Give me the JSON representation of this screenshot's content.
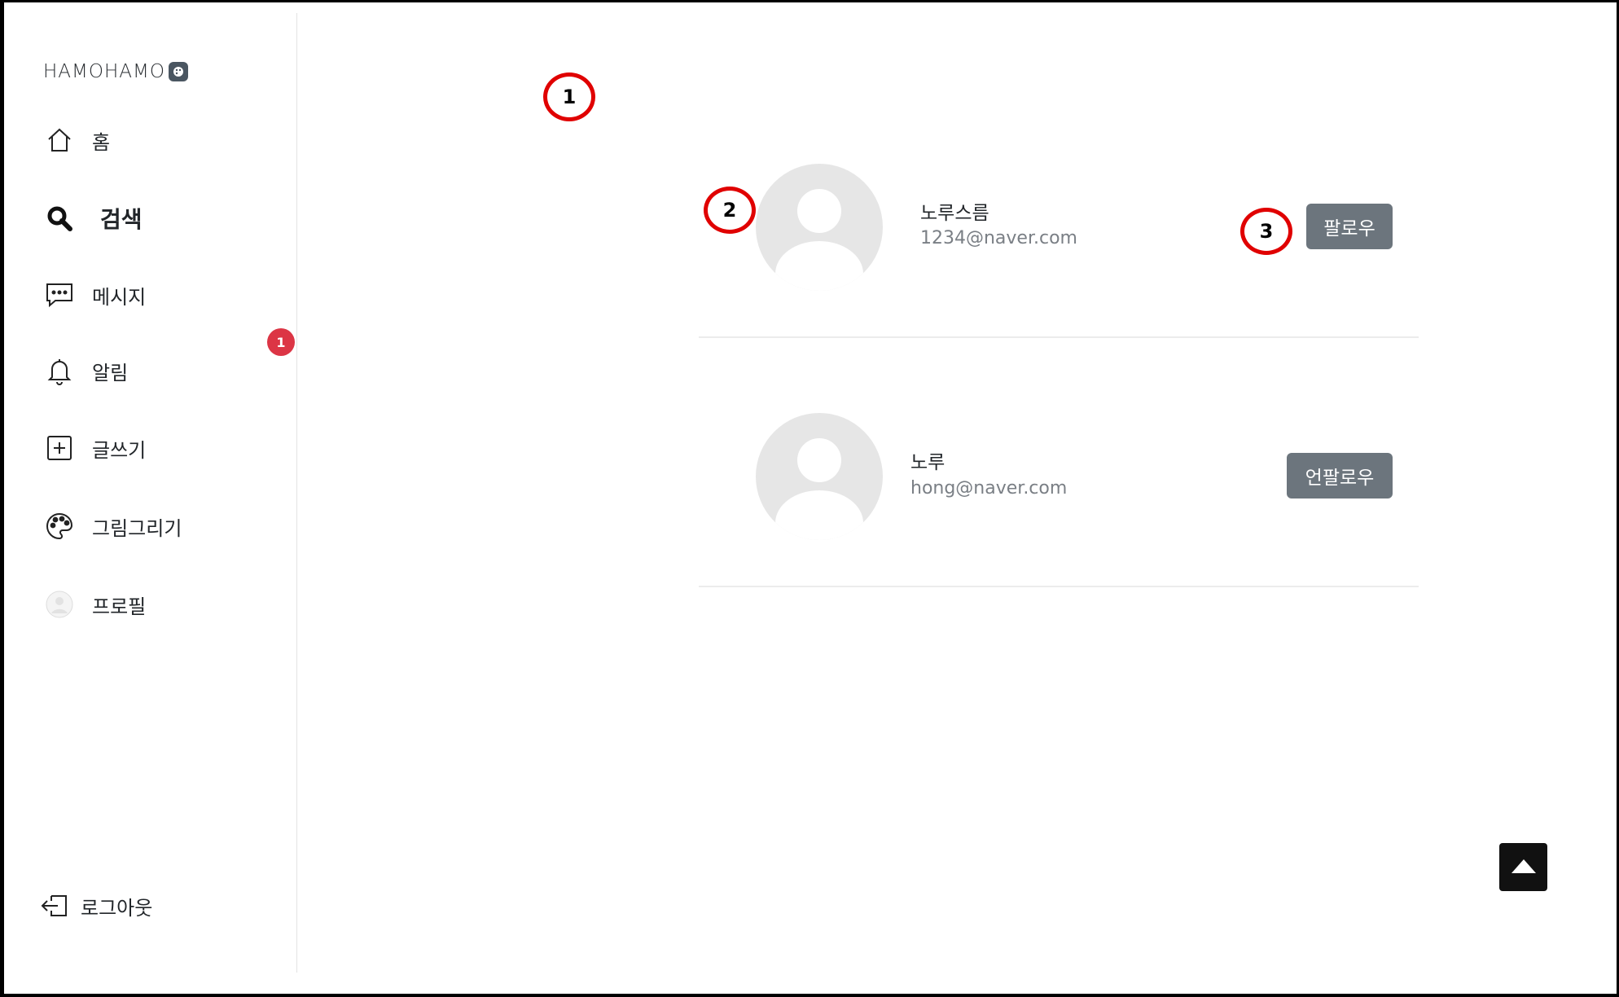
{
  "app": {
    "logo_text": "HAMOHAMO"
  },
  "sidebar": {
    "items": [
      {
        "label": "홈",
        "icon": "home-icon"
      },
      {
        "label": "검색",
        "icon": "search-icon"
      },
      {
        "label": "메시지",
        "icon": "message-icon"
      },
      {
        "label": "알림",
        "icon": "bell-icon"
      },
      {
        "label": "글쓰기",
        "icon": "plus-square-icon"
      },
      {
        "label": "그림그리기",
        "icon": "palette-icon"
      },
      {
        "label": "프로필",
        "icon": "profile-avatar-icon"
      }
    ],
    "notification_count": "1",
    "logout_label": "로그아웃"
  },
  "results": [
    {
      "name": "노루스름",
      "email": "1234@naver.com",
      "button_label": "팔로우"
    },
    {
      "name": "노루",
      "email": "hong@naver.com",
      "button_label": "언팔로우"
    }
  ],
  "annotations": [
    "1",
    "2",
    "3"
  ],
  "colors": {
    "button": "#6c757d",
    "badge": "#dc3545",
    "annotation": "#e00000"
  }
}
